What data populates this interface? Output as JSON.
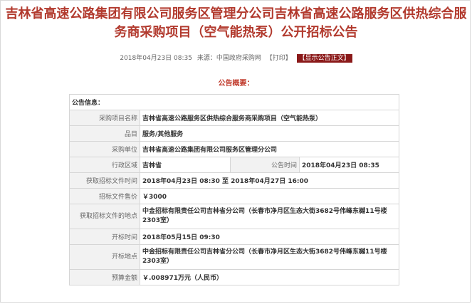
{
  "page_title": "吉林省高速公路集团有限公司服务区管理分公司吉林省高速公路服务区供热综合服务商采购项目（空气能热泵）公开招标公告",
  "meta": {
    "datetime": "2018年04月23日 08:35",
    "source": "来源：中国政府采购网",
    "print_label": "【打印】",
    "show_original_label": "【显示公告正文】"
  },
  "summary_title": "公告概要：",
  "info": {
    "section_label": "公告信息：",
    "rows": [
      {
        "label": "采购项目名称",
        "value": "吉林省高速公路服务区供热综合服务商采购项目（空气能热泵）"
      },
      {
        "label": "品目",
        "value": "服务/其他服务"
      },
      {
        "label": "采购单位",
        "value": "吉林省高速公路集团有限公司服务区管理分公司"
      },
      {
        "label": "行政区域",
        "value": "吉林省",
        "label2": "公告时间",
        "value2": "2018年04月23日 08:35"
      },
      {
        "label": "获取招标文件时间",
        "value": "2018年04月23日 08:30 至 2018年04月27日 16:00"
      },
      {
        "label": "招标文件售价",
        "value": "￥3000"
      },
      {
        "label": "获取招标文件的地点",
        "value": "中金招标有限责任公司吉林省分公司（长春市净月区生态大街3682号伟峰东樾11号楼2303室）"
      },
      {
        "label": "开标时间",
        "value": "2018年05月15日 09:30"
      },
      {
        "label": "开标地点",
        "value": "中金招标有限责任公司吉林省分公司（长春市净月区生态大街3682号伟峰东樾11号楼2303室）"
      },
      {
        "label": "预算金额",
        "value": "￥.008971万元（人民币）"
      }
    ]
  }
}
